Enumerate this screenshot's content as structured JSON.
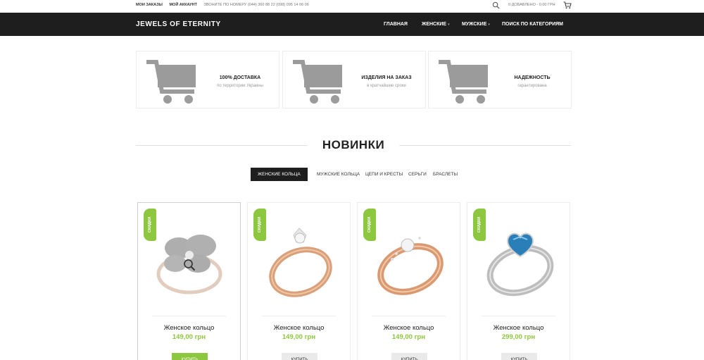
{
  "topbar": {
    "my_orders": "МОИ ЗАКАЗЫ",
    "my_account": "МОЙ АККАУНТ",
    "phone": "ЗВОНИТЕ ПО НОМЕРУ (044) 360 88 22  (098) 095 14 06 06",
    "cart_info": "0 ДОБАВЛЕНО - 0,00 ГРН"
  },
  "nav": {
    "logo": "JEWELS OF ETERNITY",
    "home": "ГЛАВНАЯ",
    "women": "ЖЕНСКИЕ",
    "men": "МУЖСКИЕ",
    "search_category": "ПОИСК ПО КАТЕГОРИЯМ"
  },
  "features": [
    {
      "title": "100% ДОСТАВКА",
      "subtitle": "по территории Украины"
    },
    {
      "title": "ИЗДЕЛИЯ НА ЗАКАЗ",
      "subtitle": "в кратчайшие сроки"
    },
    {
      "title": "НАДЕЖНОСТЬ",
      "subtitle": "гарантирована"
    }
  ],
  "section": {
    "title": "НОВИНКИ"
  },
  "tabs": [
    "ЖЕНСКИЕ КОЛЬЦА",
    "МУЖСКИЕ КОЛЬЦА",
    "ЦЕПИ И КРЕСТЫ",
    "СЕРЬГИ",
    "БРАСЛЕТЫ"
  ],
  "products": [
    {
      "badge": "СКИДКИ",
      "name": "Женское кольцо",
      "price": "149,00 грн",
      "buy": "КУПИТЬ"
    },
    {
      "badge": "СКИДКИ",
      "name": "Женское кольцо",
      "price": "149,00 грн",
      "buy": "КУПИТЬ"
    },
    {
      "badge": "СКИДКИ",
      "name": "Женское кольцо",
      "price": "149,00 грн",
      "buy": "КУПИТЬ"
    },
    {
      "badge": "СКИДКИ",
      "name": "Женское кольцо",
      "price": "299,00 грн",
      "buy": "КУПИТЬ"
    }
  ],
  "colors": {
    "accent": "#8dc63f",
    "dark": "#1e1e1e",
    "cart_gray": "#9b9b9b"
  },
  "icons": [
    "search-icon",
    "cart-icon",
    "shopping-cart-icon",
    "zoom-icon",
    "chevron-down-icon"
  ]
}
